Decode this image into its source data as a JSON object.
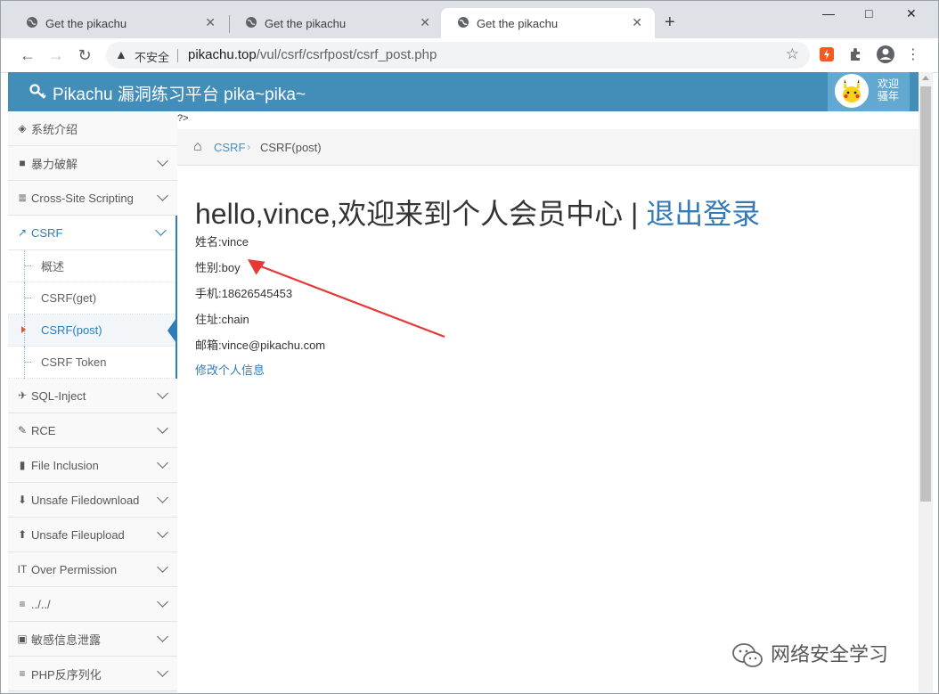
{
  "browser": {
    "tabs": [
      {
        "title": "Get the pikachu"
      },
      {
        "title": "Get the pikachu"
      },
      {
        "title": "Get the pikachu"
      }
    ],
    "address": {
      "security_label": "不安全",
      "host": "pikachu.top",
      "path": "/vul/csrf/csrfpost/csrf_post.php"
    }
  },
  "header": {
    "brand": "Pikachu 漏洞练习平台 pika~pika~",
    "user_line1": "欢迎",
    "user_line2": "骚年"
  },
  "sidebar": {
    "items": [
      {
        "label": "系统介绍",
        "icon": "tags-icon"
      },
      {
        "label": "暴力破解",
        "icon": "lock-icon"
      },
      {
        "label": "Cross-Site Scripting",
        "icon": "list-icon"
      },
      {
        "label": "CSRF",
        "icon": "share-icon"
      },
      {
        "label": "SQL-Inject",
        "icon": "plane-icon"
      },
      {
        "label": "RCE",
        "icon": "pencil-icon"
      },
      {
        "label": "File Inclusion",
        "icon": "file-icon"
      },
      {
        "label": "Unsafe Filedownload",
        "icon": "download-icon"
      },
      {
        "label": "Unsafe Fileupload",
        "icon": "upload-icon"
      },
      {
        "label": "Over Permission",
        "icon": "text-icon"
      },
      {
        "label": "../../",
        "icon": "align-icon"
      },
      {
        "label": "敏感信息泄露",
        "icon": "camera-icon"
      },
      {
        "label": "PHP反序列化",
        "icon": "align-icon"
      }
    ],
    "csrf_sub": [
      {
        "label": "概述"
      },
      {
        "label": "CSRF(get)"
      },
      {
        "label": "CSRF(post)"
      },
      {
        "label": "CSRF Token"
      }
    ]
  },
  "main": {
    "stray_text": "?>",
    "breadcrumb": {
      "link": "CSRF",
      "current": "CSRF(post)"
    },
    "welcome_text": "hello,vince,欢迎来到个人会员中心 | ",
    "logout_text": "退出登录",
    "info": [
      "姓名:vince",
      "性别:boy",
      "手机:18626545453",
      "住址:chain",
      "邮箱:vince@pikachu.com"
    ],
    "edit_link": "修改个人信息"
  },
  "watermark": "网络安全学习",
  "colors": {
    "header_blue": "#438eb9",
    "link_blue": "#337ab7",
    "annotation_red": "#e53935"
  }
}
